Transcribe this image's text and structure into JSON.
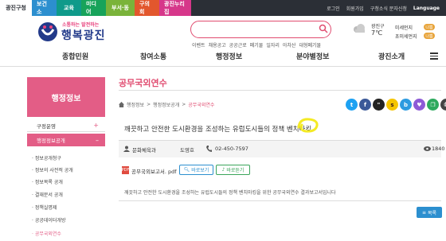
{
  "top_tabs": [
    "광진구청",
    "보건소",
    "교육",
    "미디어",
    "부서·동",
    "구의회",
    "광진누리집"
  ],
  "util_links": [
    "로그인",
    "회원가입",
    "구청소식 문자신청",
    "Language"
  ],
  "logo": {
    "tagline": "소통하는 발전하는",
    "name": "행복광진"
  },
  "search": {
    "placeholder": "",
    "keywords": [
      "이벤트",
      "채용공고",
      "공공근로",
      "폐기물",
      "일자리",
      "아차산",
      "대형폐기물"
    ]
  },
  "weather": {
    "area": "광진구",
    "temp": "7℃",
    "dust_label": "미세먼지",
    "dust_status": "나쁨",
    "ultra_label": "초미세먼지",
    "ultra_status": "나쁨"
  },
  "main_nav": [
    "종합민원",
    "참여소통",
    "행정정보",
    "분야별정보",
    "광진소개"
  ],
  "sidebar": {
    "title": "행정정보",
    "item1": "구정운영",
    "item2": "행정정보공개",
    "sub": [
      "정보공개청구",
      "정보의 사전적 공개",
      "정보목록 공개",
      "결재문서 공개",
      "정책실명제",
      "공공데이터개방",
      "공무국외연수"
    ]
  },
  "page_title": "공무국외연수",
  "breadcrumb": [
    "행정정보",
    "행정정보공개",
    "공무국외연수"
  ],
  "article": {
    "title": "깨끗하고 안전한 도시환경을 조성하는 유럽도시들의 정책 벤치마킹",
    "dept": "문화체육과",
    "person": "도영호",
    "phone": "02-450-7597",
    "views": "1840",
    "file": "공무국외보고서. pdf",
    "view_label": "바로보기",
    "listen_label": "바로듣기",
    "desc": "깨끗하고 안전한 도시환경을 조성하는 유럽도시들의 정책 벤치마킹을 위한 공무국외연수 결과보고서입니다"
  },
  "list_label": "목록"
}
